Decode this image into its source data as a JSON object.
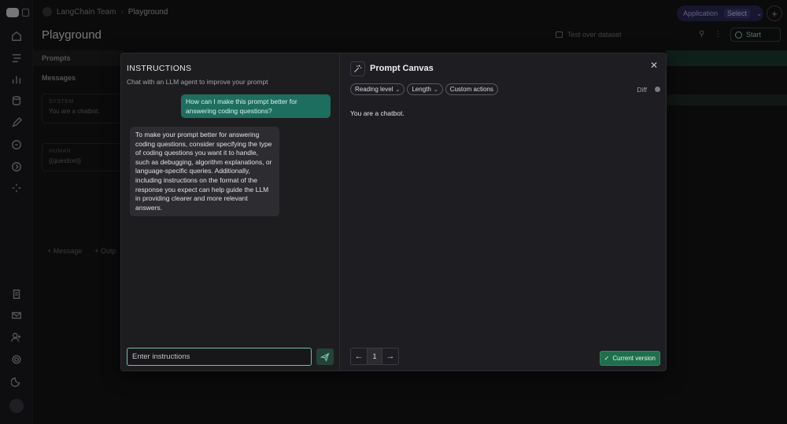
{
  "breadcrumb": {
    "workspace": "LangChain Team",
    "page": "Playground"
  },
  "app_selector": {
    "label": "Application",
    "select": "Select"
  },
  "page_title": "Playground",
  "dataset": {
    "placeholder": "Test over dataset"
  },
  "start_button": "Start",
  "left_panel": {
    "prompts_label": "Prompts",
    "messages_label": "Messages",
    "system_role": "SYSTEM",
    "system_text": "You are a chatbot.",
    "human_role": "HUMAN",
    "human_text": "{{question}}",
    "add_message": "+ Message",
    "add_output": "+ Outp"
  },
  "instructions": {
    "title": "INSTRUCTIONS",
    "subtitle": "Chat with an LLM agent to improve your prompt",
    "user_message": "How can I make this prompt better for answering coding questions?",
    "assistant_message": "To make your prompt better for answering coding questions, consider specifying the type of coding questions you want it to handle, such as debugging, algorithm explanations, or language-specific queries. Additionally, including instructions on the format of the response you expect can help guide the LLM in providing clearer and more relevant answers.",
    "input_placeholder": "Enter instructions"
  },
  "canvas": {
    "title": "Prompt Canvas",
    "chips": [
      "Reading level",
      "Length",
      "Custom actions"
    ],
    "diff_label": "Diff",
    "prompt_text": "You are a chatbot.",
    "page_number": "1",
    "current_version_label": "Current version"
  },
  "colors": {
    "accent_teal": "#1e6e60",
    "current_version_green": "#1f6f4d",
    "app_purple": "#2b2854"
  },
  "icons": {
    "rail": [
      "home-icon",
      "tracing-icon",
      "dashboards-icon",
      "datasets-icon",
      "annotation-icon",
      "prompts-icon",
      "deployments-icon",
      "settings-cog-icon",
      "docs-icon",
      "mail-icon",
      "user-add-icon",
      "gear-icon",
      "moon-icon"
    ],
    "canvas": "magic-wand-icon"
  }
}
